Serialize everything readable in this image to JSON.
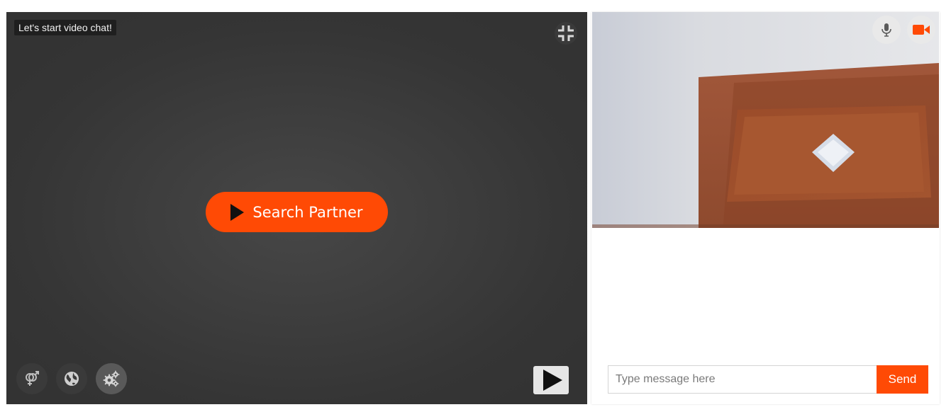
{
  "video_stage": {
    "status_text": "Let's start video chat!",
    "search_button_label": "Search Partner",
    "icons": {
      "exit_fullscreen": "compress-icon",
      "gender_filter": "gender-icon",
      "country_filter": "globe-icon",
      "settings": "gears-icon",
      "play": "play-icon"
    }
  },
  "self_camera": {
    "mic_icon": "microphone-icon",
    "camera_icon": "video-camera-icon"
  },
  "chat": {
    "placeholder": "Type message here",
    "send_label": "Send"
  },
  "colors": {
    "accent": "#ff4a05",
    "stage_background": "#3d3d3d"
  }
}
